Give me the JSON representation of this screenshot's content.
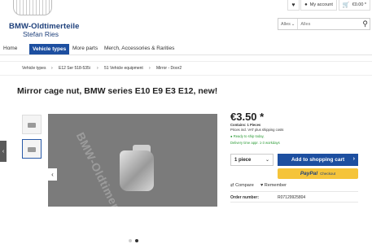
{
  "brand": {
    "name": "BMW-Oldtimerteile",
    "owner": "Stefan Ries"
  },
  "header": {
    "account_label": "My account",
    "cart_total": "€0.00 *"
  },
  "search": {
    "category": "Alles",
    "placeholder": "Alles"
  },
  "nav": {
    "items": [
      "Home",
      "Vehicle types",
      "More parts",
      "Merch, Accessories & Rarities"
    ],
    "active_index": 1
  },
  "breadcrumb": [
    "Vehicle types",
    "E12 Ser 518-535i",
    "51 Vehicle equipment",
    "Mirror - Door2"
  ],
  "product": {
    "title": "Mirror cage nut, BMW series E10 E9 E3 E12, new!",
    "price": "€3.50 *",
    "contains": "Contains: 1 Pieces",
    "tax_note": "Prices incl. VAT plus shipping costs",
    "stock": "Ready to ship today,",
    "delivery": "Delivery time appr. 1-3 workdays",
    "image_watermark": "BMW-Oldtimerte"
  },
  "buy": {
    "qty": "1 piece",
    "cart_label": "Add to shopping cart",
    "paypal_brand": "PayPal",
    "paypal_checkout": "Checkout"
  },
  "actions": {
    "compare": "Compare",
    "remember": "Remember"
  },
  "order": {
    "label": "Order number:",
    "value": "R07129925804"
  },
  "colors": {
    "accent": "#1d4fa0",
    "paypal": "#f5c43a",
    "stock": "#2b9b36"
  }
}
